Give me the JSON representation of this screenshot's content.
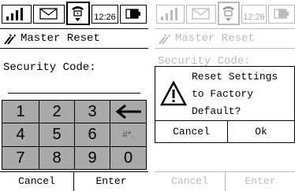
{
  "left_screen": {
    "status": {
      "time": "12:26"
    },
    "title": "Master Reset",
    "security_label": "Security Code:",
    "security_value": "",
    "keypad": {
      "keys": [
        "1",
        "2",
        "3",
        "←",
        "4",
        "5",
        "6",
        "#*.",
        "7",
        "8",
        "9",
        "0"
      ]
    },
    "softkeys": {
      "left": "Cancel",
      "right": "Enter"
    }
  },
  "right_screen": {
    "status": {
      "time": "12:26"
    },
    "title": "Master Reset",
    "security_label": "Security Code:",
    "dialog": {
      "line1": "Reset Settings",
      "line2": "to Factory",
      "line3": "Default?",
      "cancel": "Cancel",
      "ok": "Ok",
      "icon": "warning-icon"
    },
    "softkeys": {
      "left": "Cancel",
      "right": "Enter"
    }
  },
  "icons": [
    "signal-strength-icon",
    "envelope-icon",
    "phone-lock-icon",
    "battery-icon",
    "tools-icon",
    "backspace-arrow-icon",
    "warning-icon"
  ]
}
